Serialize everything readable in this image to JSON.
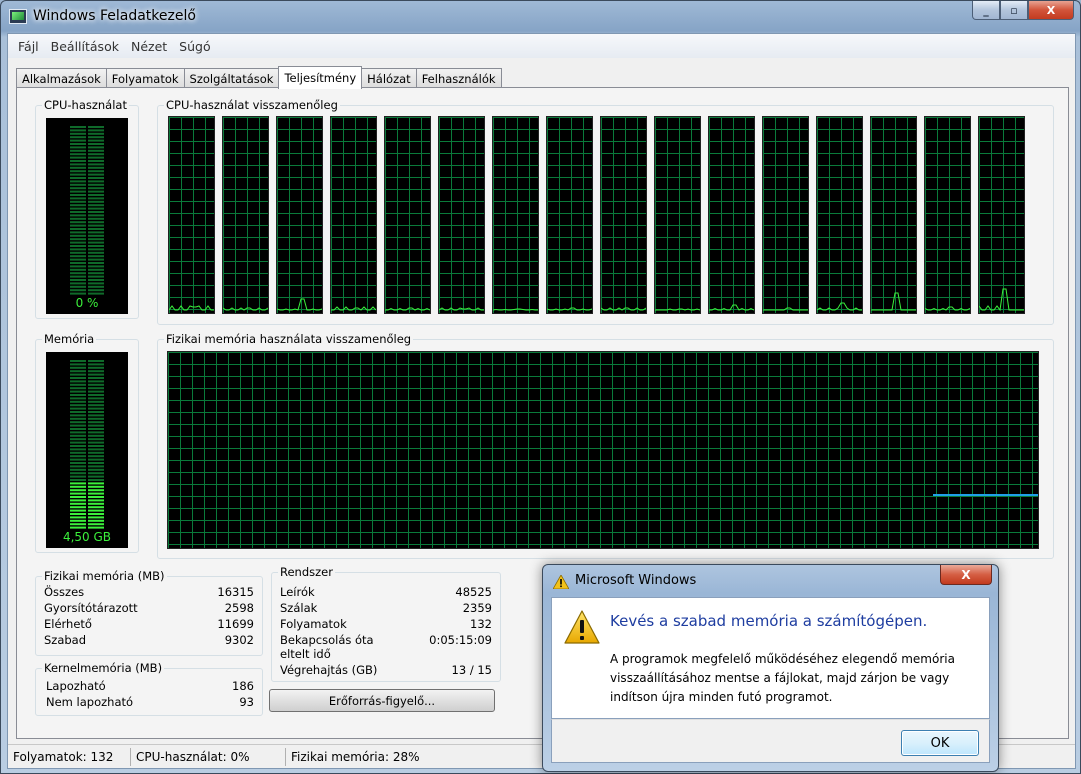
{
  "window": {
    "title": "Windows Feladatkezelő"
  },
  "menu": [
    "Fájl",
    "Beállítások",
    "Nézet",
    "Súgó"
  ],
  "tabs": [
    "Alkalmazások",
    "Folyamatok",
    "Szolgáltatások",
    "Teljesítmény",
    "Hálózat",
    "Felhasználók"
  ],
  "active_tab": "Teljesítmény",
  "cpu": {
    "label": "CPU-használat",
    "value": "0 %",
    "history_label": "CPU-használat visszamenőleg"
  },
  "memory": {
    "label": "Memória",
    "value": "4,50 GB",
    "history_label": "Fizikai memória használata visszamenőleg"
  },
  "physical_memory": {
    "label": "Fizikai memória (MB)",
    "rows": [
      {
        "name": "Összes",
        "value": "16315"
      },
      {
        "name": "Gyorsítótárazott",
        "value": "2598"
      },
      {
        "name": "Elérhető",
        "value": "11699"
      },
      {
        "name": "Szabad",
        "value": "9302"
      }
    ]
  },
  "kernel_memory": {
    "label": "Kernelmemória (MB)",
    "rows": [
      {
        "name": "Lapozható",
        "value": "186"
      },
      {
        "name": "Nem lapozható",
        "value": "93"
      }
    ]
  },
  "system": {
    "label": "Rendszer",
    "rows": [
      {
        "name": "Leírók",
        "value": "48525"
      },
      {
        "name": "Szálak",
        "value": "2359"
      },
      {
        "name": "Folyamatok",
        "value": "132"
      },
      {
        "name": "Bekapcsolás óta eltelt idő",
        "value": "0:05:15:09"
      },
      {
        "name": "Végrehajtás (GB)",
        "value": "13 / 15"
      }
    ]
  },
  "resource_monitor_button": "Erőforrás-figyelő...",
  "status": {
    "processes": "Folyamatok: 132",
    "cpu": "CPU-használat: 0%",
    "memory": "Fizikai memória: 28%"
  },
  "dialog": {
    "title": "Microsoft Windows",
    "close": "X",
    "heading": "Kevés a szabad memória a számítógépen.",
    "text": "A programok megfelelő működéséhez elegendő memória visszaállításához mentse a fájlokat, majd zárjon be vagy indítson újra minden futó programot.",
    "ok": "OK"
  },
  "window_buttons": {
    "minimize": "_",
    "restore": "▫",
    "close": "X"
  },
  "colors": {
    "graph_line": "#3bf03b",
    "memory_line": "#1f9fe8",
    "grid": "#0a7a3a"
  }
}
